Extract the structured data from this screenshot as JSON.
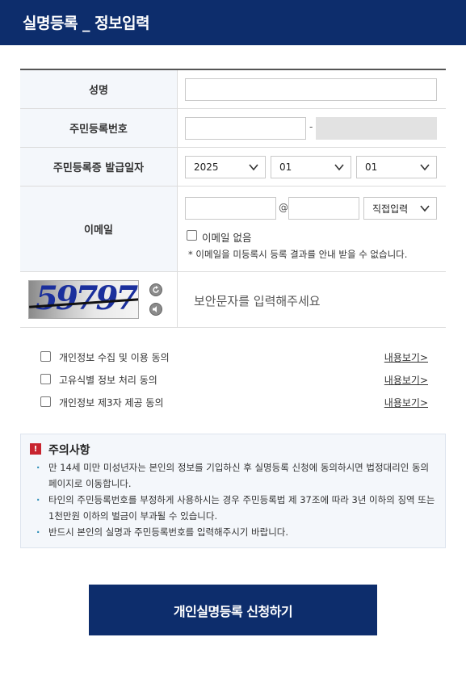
{
  "header": {
    "title": "실명등록 _ 정보입력"
  },
  "form": {
    "name": {
      "label": "성명",
      "value": ""
    },
    "rrn": {
      "label": "주민등록번호",
      "front_value": "",
      "separator": "-",
      "back_value": ""
    },
    "issue_date": {
      "label": "주민등록증 발급일자",
      "year": "2025",
      "month": "01",
      "day": "01"
    },
    "email": {
      "label": "이메일",
      "local_value": "",
      "at": "@",
      "domain_value": "",
      "domain_select": "직접입력",
      "no_email_label": "이메일 없음",
      "notice": "* 이메일을 미등록시 등록 결과를 안내 받을 수 없습니다."
    },
    "captcha": {
      "image_text": "59797",
      "placeholder": "보안문자를 입력해주세요"
    }
  },
  "agreements": [
    {
      "label": "개인정보 수집 및 이용 동의",
      "link": "내용보기>"
    },
    {
      "label": "고유식별 정보 처리 동의",
      "link": "내용보기>"
    },
    {
      "label": "개인정보 제3자 제공 동의",
      "link": "내용보기>"
    }
  ],
  "notice": {
    "title": "주의사항",
    "items": [
      "만 14세 미만 미성년자는 본인의 정보를 기입하신 후 실명등록 신청에 동의하시면 법정대리인 동의 페이지로 이동합니다.",
      "타인의 주민등록번호를 부정하게 사용하시는 경우 주민등록법 제 37조에 따라 3년 이하의 징역 또는 1천만원 이하의 벌금이 부과될 수 있습니다.",
      "반드시 본인의 실명과 주민등록번호를 입력해주시기 바랍니다."
    ]
  },
  "submit": {
    "label": "개인실명등록 신청하기"
  },
  "colors": {
    "brand": "#0d2d6c",
    "warning": "#c8242f",
    "bullet": "#2f8fb8"
  },
  "icons": {
    "select_arrow": "chevron-down-icon",
    "refresh": "refresh-icon",
    "audio": "speaker-icon",
    "warning": "exclamation-icon"
  }
}
